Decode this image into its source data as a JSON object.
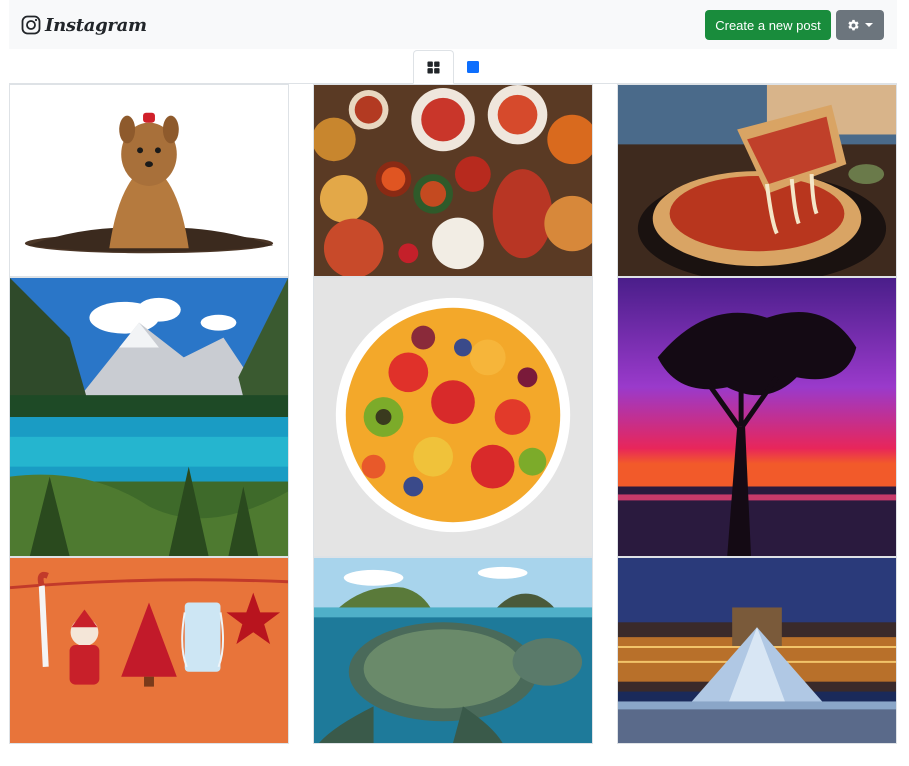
{
  "navbar": {
    "brand_text": "Instagram",
    "brand_icon": "instagram-icon",
    "create_button_label": "Create a new post",
    "settings_icon": "gear-icon"
  },
  "view_tabs": [
    {
      "icon": "grid-icon",
      "active": true
    },
    {
      "icon": "square-icon",
      "active": false
    }
  ],
  "colors": {
    "create_button": "#198c3c",
    "settings_button": "#6c757d",
    "square_icon": "#0d6efd",
    "navbar_bg": "#f8f9fa"
  },
  "posts": [
    {
      "name": "yorkshire-terrier-photo"
    },
    {
      "name": "indian-food-spread-photo"
    },
    {
      "name": "deep-dish-pizza-photo"
    },
    {
      "name": "mountain-lake-photo"
    },
    {
      "name": "fruit-salad-bowl-photo"
    },
    {
      "name": "sunset-tree-photo"
    },
    {
      "name": "christmas-decorations-mask-photo"
    },
    {
      "name": "sea-turtle-island-photo"
    },
    {
      "name": "louvre-pyramid-night-photo"
    }
  ]
}
